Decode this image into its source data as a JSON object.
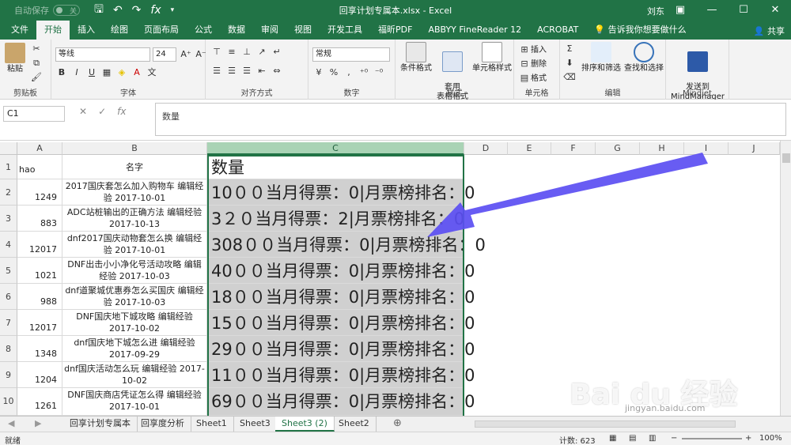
{
  "titlebar": {
    "autosave_label": "自动保存",
    "autosave_state": "关",
    "title": "回享计划专属本.xlsx - Excel",
    "user": "刘东"
  },
  "tabs": [
    "文件",
    "开始",
    "插入",
    "绘图",
    "页面布局",
    "公式",
    "数据",
    "审阅",
    "视图",
    "开发工具",
    "福昕PDF",
    "ABBYY FineReader 12",
    "ACROBAT",
    "告诉我你想要做什么"
  ],
  "share_label": "共享",
  "ribbon": {
    "paste": "粘贴",
    "clipboard": "剪贴板",
    "font_name": "等线",
    "font_size": "24",
    "font_group": "字体",
    "align_group": "对齐方式",
    "number_format": "常规",
    "number_group": "数字",
    "cond_format": "条件格式",
    "table_format": "套用\n表格格式",
    "cell_style": "单元格样式",
    "style_group": "样式",
    "insert": "插入",
    "delete": "删除",
    "format": "格式",
    "cells_group": "单元格",
    "sort_filter": "排序和筛选",
    "find_select": "查找和选择",
    "edit_group": "编辑",
    "send_mm": "发送到\nMindManager",
    "mindjet_group": "Mindjet"
  },
  "formula": {
    "namebox": "C1",
    "content": "数量"
  },
  "columns": [
    "A",
    "B",
    "C",
    "D",
    "E",
    "F",
    "G",
    "H",
    "I",
    "J"
  ],
  "rows": [
    {
      "num": "1",
      "a": "hao",
      "b": "名字",
      "c": "数量"
    },
    {
      "num": "2",
      "a": "1249",
      "b": "2017国庆套怎么加入购物车 编辑经验 2017-10-01",
      "c": "10００当月得票：0|月票榜排名：0"
    },
    {
      "num": "3",
      "a": "883",
      "b": "ADC站桩输出的正确方法 编辑经验 2017-10-13",
      "c": "3２０当月得票：2|月票榜排名：0"
    },
    {
      "num": "4",
      "a": "12017",
      "b": "dnf2017国庆动物套怎么换 编辑经验 2017-10-01",
      "c": "308００当月得票：0|月票榜排名：0"
    },
    {
      "num": "5",
      "a": "1021",
      "b": "DNF出击小小净化号活动攻略 编辑经验 2017-10-03",
      "c": "40００当月得票：0|月票榜排名：0"
    },
    {
      "num": "6",
      "a": "988",
      "b": "dnf道聚城优惠券怎么买国庆 编辑经验 2017-10-03",
      "c": "18００当月得票：0|月票榜排名：0"
    },
    {
      "num": "7",
      "a": "12017",
      "b": "DNF国庆地下城攻略 编辑经验 2017-10-02",
      "c": "15００当月得票：0|月票榜排名：0"
    },
    {
      "num": "8",
      "a": "1348",
      "b": "dnf国庆地下城怎么进 编辑经验 2017-09-29",
      "c": "29００当月得票：0|月票榜排名：0"
    },
    {
      "num": "9",
      "a": "1204",
      "b": "dnf国庆活动怎么玩 编辑经验 2017-10-02",
      "c": "11００当月得票：0|月票榜排名：0"
    },
    {
      "num": "10",
      "a": "1261",
      "b": "DNF国庆商店凭证怎么得 编辑经验 2017-10-01",
      "c": "69００当月得票：0|月票榜排名：0"
    }
  ],
  "sheets": [
    "回享计划专属本",
    "回享度分析",
    "Sheet1",
    "Sheet3",
    "Sheet3 (2)",
    "Sheet2"
  ],
  "active_sheet": "Sheet3 (2)",
  "status": {
    "mode": "就绪",
    "count": "计数: 623",
    "zoom": "100%"
  },
  "watermark": {
    "text": "Bai du 经验",
    "url": "jingyan.baidu.com"
  },
  "colors": {
    "excel_green": "#217346",
    "arrow": "#5b4ef2"
  }
}
